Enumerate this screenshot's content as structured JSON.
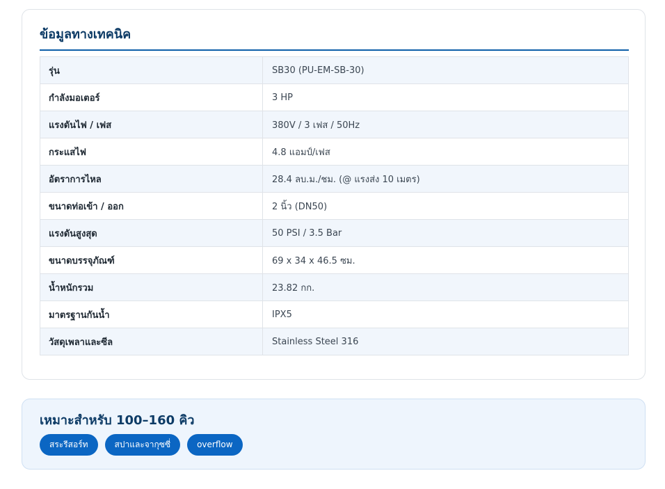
{
  "specs": {
    "title": "ข้อมูลทางเทคนิค",
    "rows": [
      {
        "label": "รุ่น",
        "value": "SB30 (PU-EM-SB-30)"
      },
      {
        "label": "กำลังมอเตอร์",
        "value": "3 HP"
      },
      {
        "label": "แรงดันไฟ / เฟส",
        "value": "380V / 3 เฟส / 50Hz"
      },
      {
        "label": "กระแสไฟ",
        "value": "4.8 แอมป์/เฟส"
      },
      {
        "label": "อัตราการไหล",
        "value": "28.4 ลบ.ม./ชม. (@ แรงส่ง 10 เมตร)"
      },
      {
        "label": "ขนาดท่อเข้า / ออก",
        "value": "2 นิ้ว (DN50)"
      },
      {
        "label": "แรงดันสูงสุด",
        "value": "50 PSI / 3.5 Bar"
      },
      {
        "label": "ขนาดบรรจุภัณฑ์",
        "value": "69 x 34 x 46.5 ซม."
      },
      {
        "label": "น้ำหนักรวม",
        "value": "23.82 กก."
      },
      {
        "label": "มาตรฐานกันน้ำ",
        "value": "IPX5"
      },
      {
        "label": "วัสดุเพลาและซีล",
        "value": "Stainless Steel 316"
      }
    ]
  },
  "suitable": {
    "title": "เหมาะสำหรับ 100–160 คิว",
    "tags": [
      "สระรีสอร์ท",
      "สปาและจากุซซี่",
      "overflow"
    ]
  },
  "colors": {
    "heading": "#0d3b66",
    "accent": "#0b66c3",
    "row_alt": "#f1f6fc"
  }
}
